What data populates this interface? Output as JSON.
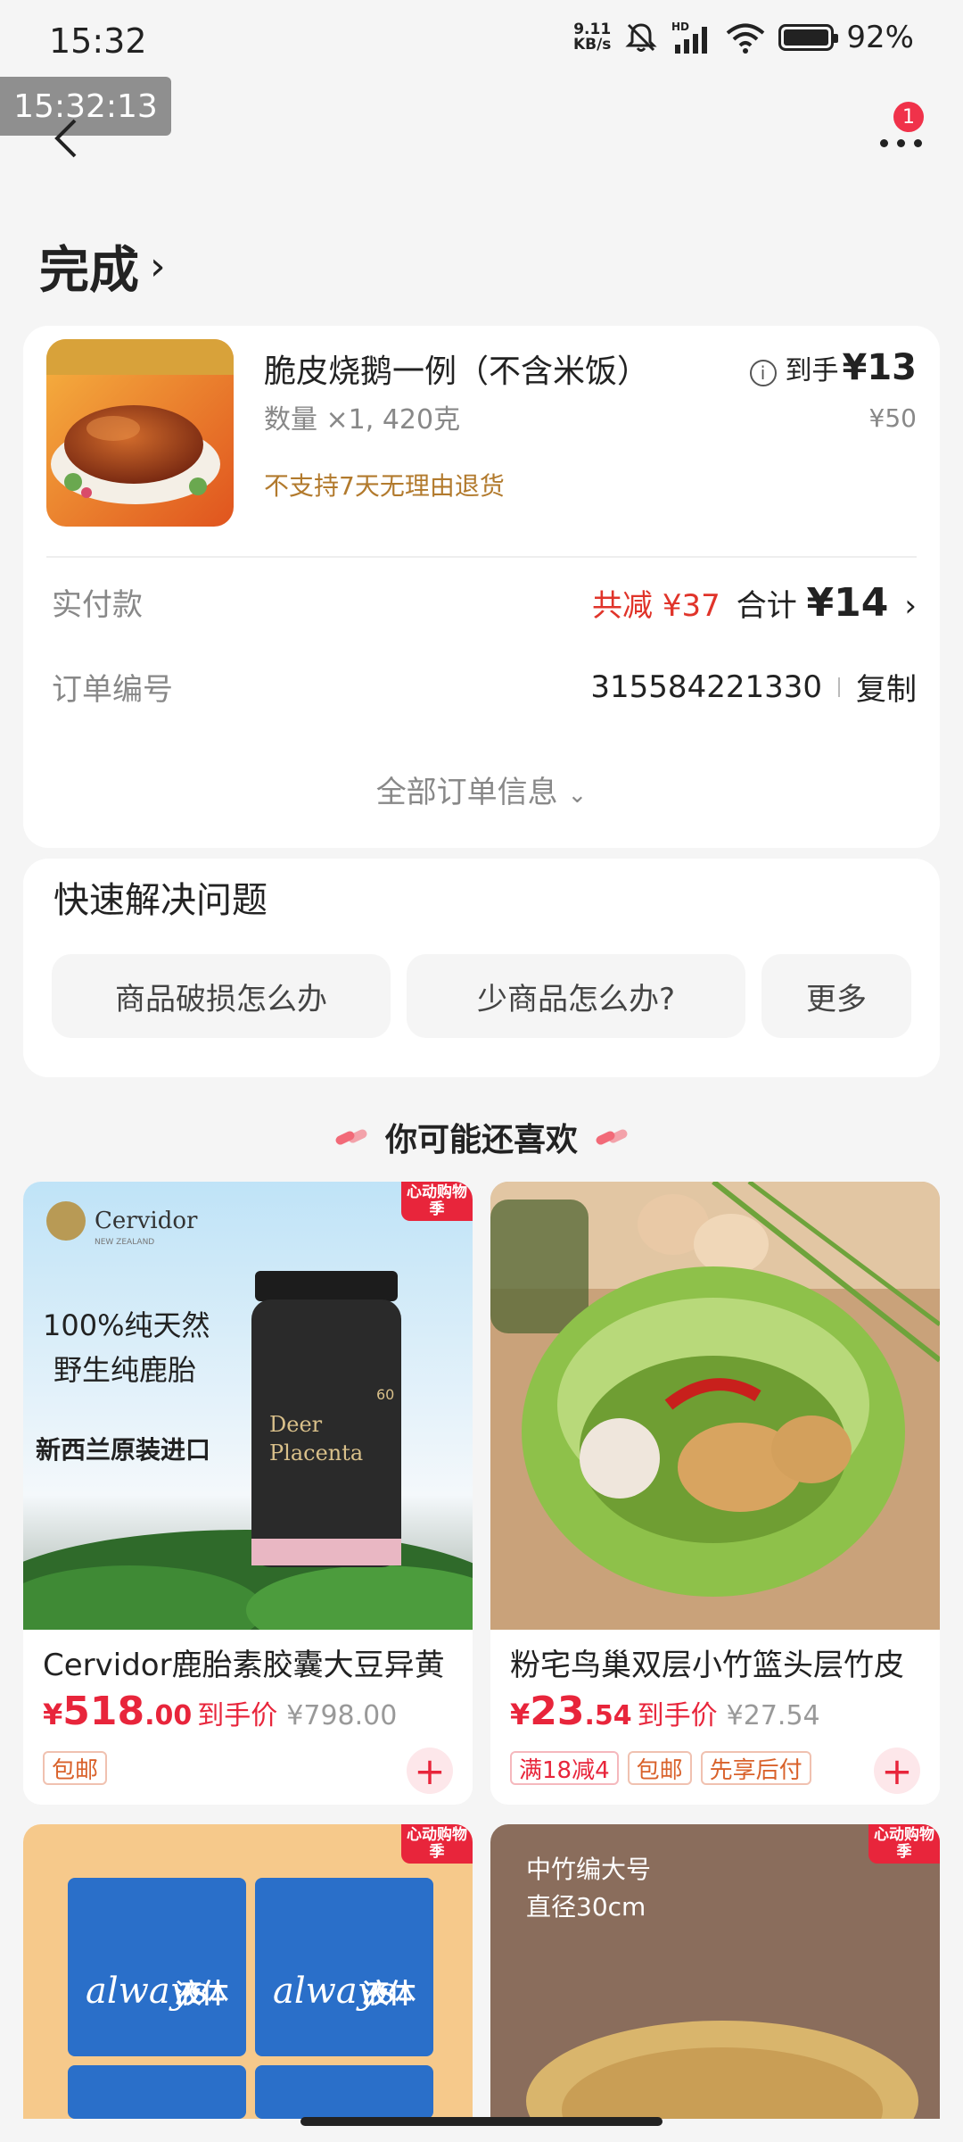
{
  "status_bar": {
    "time": "15:32",
    "net_speed_top": "9.11",
    "net_speed_bottom": "KB/s",
    "network": "HD",
    "battery": "92%"
  },
  "timestamp_overlay": "15:32:13",
  "header": {
    "more_badge_count": "1"
  },
  "order": {
    "status": "完成",
    "product": {
      "name": "脆皮烧鹅一例（不含米饭）",
      "quantity": "数量 ×1, 420克",
      "return_policy": "不支持7天无理由退货",
      "final_price_label": "到手",
      "final_price": "¥13",
      "original_price": "¥50"
    },
    "payment": {
      "label": "实付款",
      "discount": "共减 ¥37",
      "total_label": "合计",
      "total": "¥14"
    },
    "order_number": {
      "label": "订单编号",
      "value": "315584221330",
      "copy_label": "复制"
    },
    "all_info_label": "全部订单信息"
  },
  "quick_resolve": {
    "title": "快速解决问题",
    "buttons": [
      "商品破损怎么办",
      "少商品怎么办?",
      "更多"
    ]
  },
  "recommendations": {
    "title": "你可能还喜欢",
    "items": [
      {
        "title": "Cervidor鹿胎素胶囊大豆异黄",
        "price_int": "518",
        "price_dec": ".00",
        "price_label": "到手价",
        "original_price": "¥798.00",
        "tags": [
          "包邮"
        ],
        "promo": "心动购物季",
        "image_text": {
          "brand": "Cervidor",
          "brand_sub": "NEW ZEALAND",
          "line1": "100%纯天然",
          "line2": "野生纯鹿胎",
          "line3": "新西兰原装进口",
          "bottle_label_1": "Deer",
          "bottle_label_2": "Placenta",
          "bottle_count": "60"
        }
      },
      {
        "title": "粉宅鸟巢双层小竹篮头层竹皮",
        "price_int": "23",
        "price_dec": ".54",
        "price_label": "到手价",
        "original_price": "¥27.54",
        "tags": [
          "满18减4",
          "包邮",
          "先享后付"
        ]
      },
      {
        "promo": "心动购物季",
        "image_text": {
          "brand": "always",
          "product": "液体"
        }
      },
      {
        "promo": "心动购物季",
        "image_text": {
          "line1": "中竹编大号",
          "line2": "直径30cm"
        }
      }
    ]
  },
  "colors": {
    "accent_red": "#e8253b",
    "discount_red": "#e0342a",
    "notice_brown": "#b27a2d"
  }
}
